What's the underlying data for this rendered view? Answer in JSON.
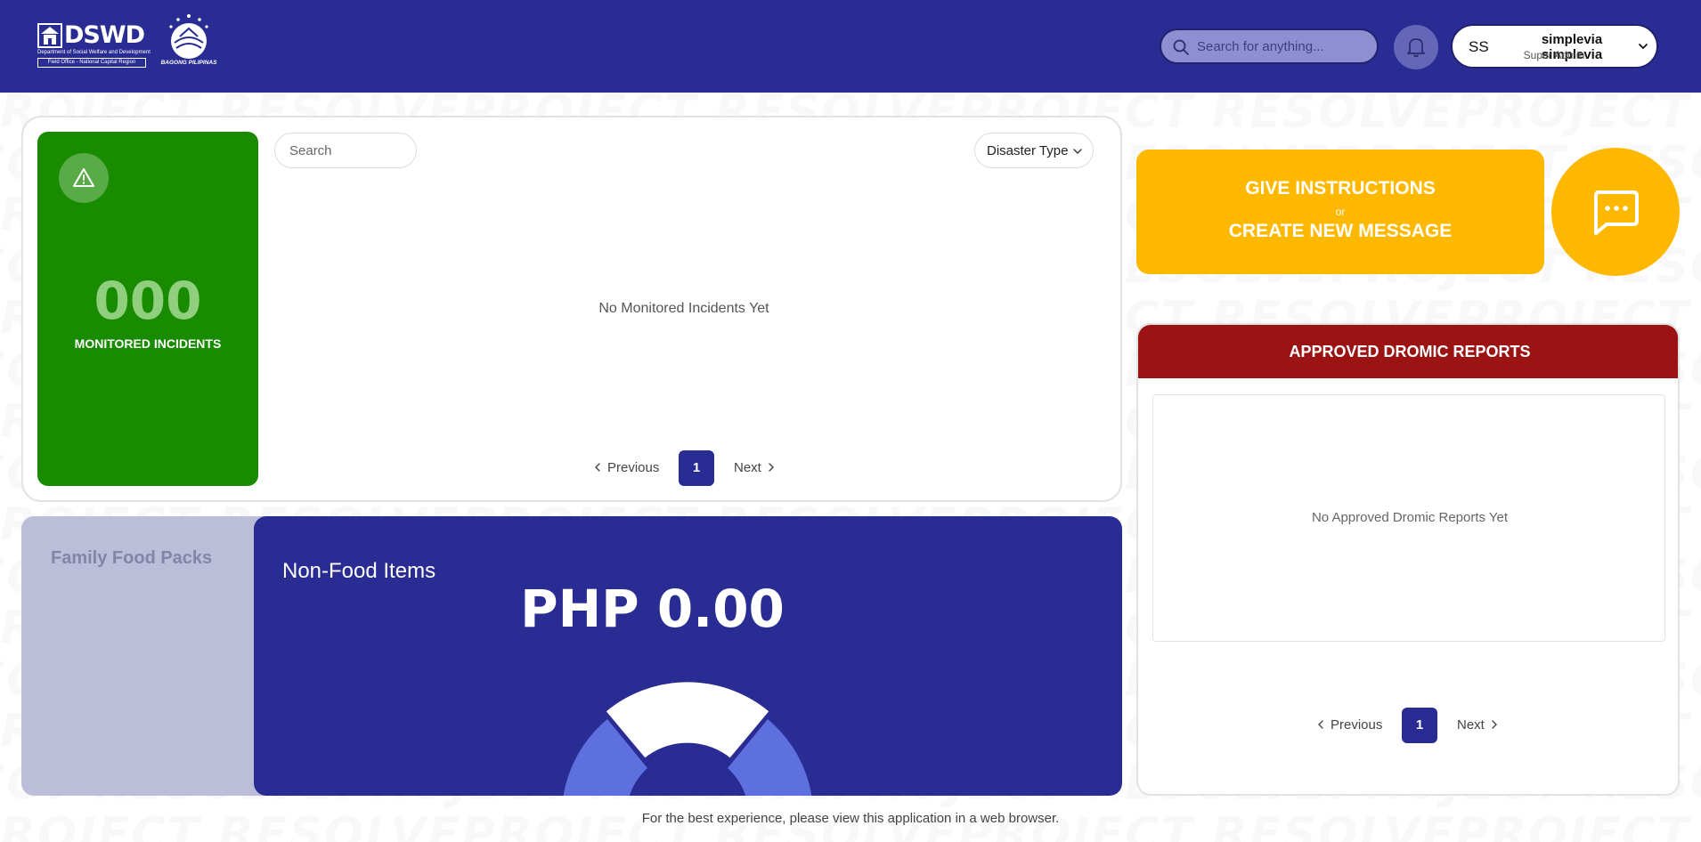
{
  "header": {
    "logo": {
      "name": "DSWD",
      "department": "Department of Social Welfare and Development",
      "office": "Field Office - National Capital Region"
    },
    "secondary_logo": "BAGONG PILIPINAS",
    "search_placeholder": "Search for anything...",
    "notification_icon": "bell-icon",
    "user": {
      "initials": "SS",
      "name": "simplevia simplevia",
      "role": "Super Admin"
    }
  },
  "watermark_text": "PROJECT RESOLVE",
  "incidents": {
    "count": "000",
    "label": "MONITORED INCIDENTS",
    "search_placeholder": "Search",
    "filter_label": "Disaster Type",
    "empty_message": "No Monitored Incidents Yet",
    "pagination": {
      "prev": "Previous",
      "page": "1",
      "next": "Next"
    }
  },
  "food_packs": {
    "family_label": "Family Food Packs",
    "nonfood_label": "Non-Food Items",
    "amount": "PHP 0.00"
  },
  "instructions": {
    "line1": "GIVE INSTRUCTIONS",
    "or": "or",
    "line2": "CREATE NEW MESSAGE"
  },
  "dromic": {
    "title": "APPROVED DROMIC REPORTS",
    "empty_message": "No Approved Dromic Reports Yet",
    "pagination": {
      "prev": "Previous",
      "page": "1",
      "next": "Next"
    }
  },
  "footer_note": "For the best experience, please view this application in a web browser.",
  "colors": {
    "header": "#292c92",
    "monitored": "#198b00",
    "accent_yellow": "#ffb800",
    "dromic_header": "#9b1313",
    "page_active": "#292c92"
  }
}
